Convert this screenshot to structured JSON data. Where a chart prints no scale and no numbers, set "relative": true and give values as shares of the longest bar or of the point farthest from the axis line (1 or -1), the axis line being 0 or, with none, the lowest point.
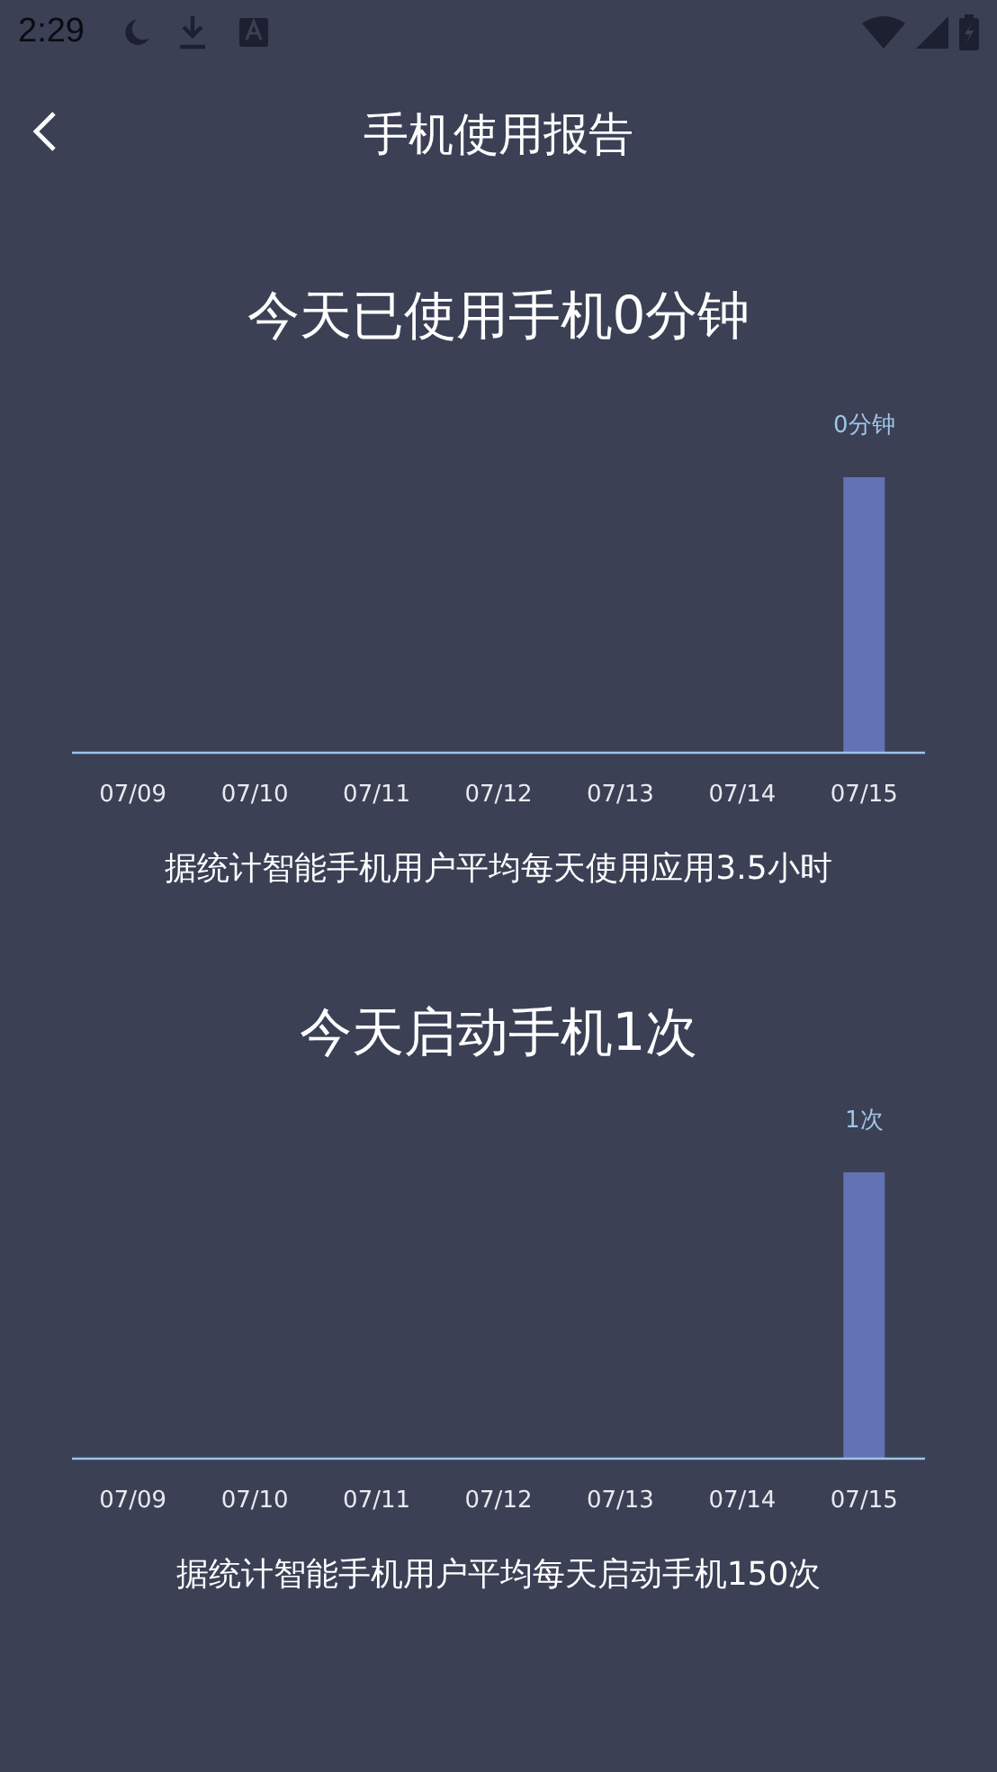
{
  "status_bar": {
    "time": "2:29"
  },
  "header": {
    "title": "手机使用报告"
  },
  "sections": [
    {
      "heading": "今天已使用手机0分钟",
      "chart_data": {
        "type": "bar",
        "relative": true,
        "categories": [
          "07/09",
          "07/10",
          "07/11",
          "07/12",
          "07/13",
          "07/14",
          "07/15"
        ],
        "values": [
          0,
          0,
          0,
          0,
          0,
          0,
          1
        ],
        "annotations": [
          "0分钟"
        ]
      },
      "note": "据统计智能手机用户平均每天使用应用3.5小时"
    },
    {
      "heading": "今天启动手机1次",
      "chart_data": {
        "type": "bar",
        "relative": true,
        "categories": [
          "07/09",
          "07/10",
          "07/11",
          "07/12",
          "07/13",
          "07/14",
          "07/15"
        ],
        "values": [
          0,
          0,
          0,
          0,
          0,
          0,
          1
        ],
        "annotations": [
          "1次"
        ]
      },
      "note": "据统计智能手机用户平均每天启动手机150次"
    }
  ]
}
